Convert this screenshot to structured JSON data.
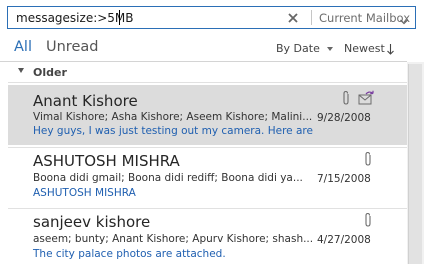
{
  "search": {
    "query": "messagesize:>5MB",
    "scope": "Current Mailbox"
  },
  "filters": {
    "all": "All",
    "unread": "Unread",
    "sort_by": "By Date",
    "sort_order": "Newest"
  },
  "group": {
    "label": "Older"
  },
  "emails": [
    {
      "sender": "Anant Kishore",
      "recipients": "Vimal Kishore; Asha Kishore; Aseem Kishore; Malini...",
      "preview": "Hey guys,  I was just testing out my camera. Here are",
      "date": "9/28/2008",
      "has_attachment": true,
      "reply_icon": "reply-arrow-icon",
      "selected": true
    },
    {
      "sender": "ASHUTOSH MISHRA",
      "recipients": "Boona didi gmail; Boona didi rediff; Boona didi ya...",
      "preview": "ASHUTOSH  MISHRA",
      "date": "7/15/2008",
      "has_attachment": true,
      "selected": false
    },
    {
      "sender": "sanjeev kishore",
      "recipients": "aseem; bunty; Anant Kishore; Apurv Kishore; shash...",
      "preview": "The city palace photos are attached.",
      "date": "4/27/2008",
      "has_attachment": true,
      "selected": false
    }
  ],
  "colors": {
    "accent": "#2b6fb6",
    "selected_row": "#dcdcdc",
    "preview_text": "#1f5fb0"
  }
}
